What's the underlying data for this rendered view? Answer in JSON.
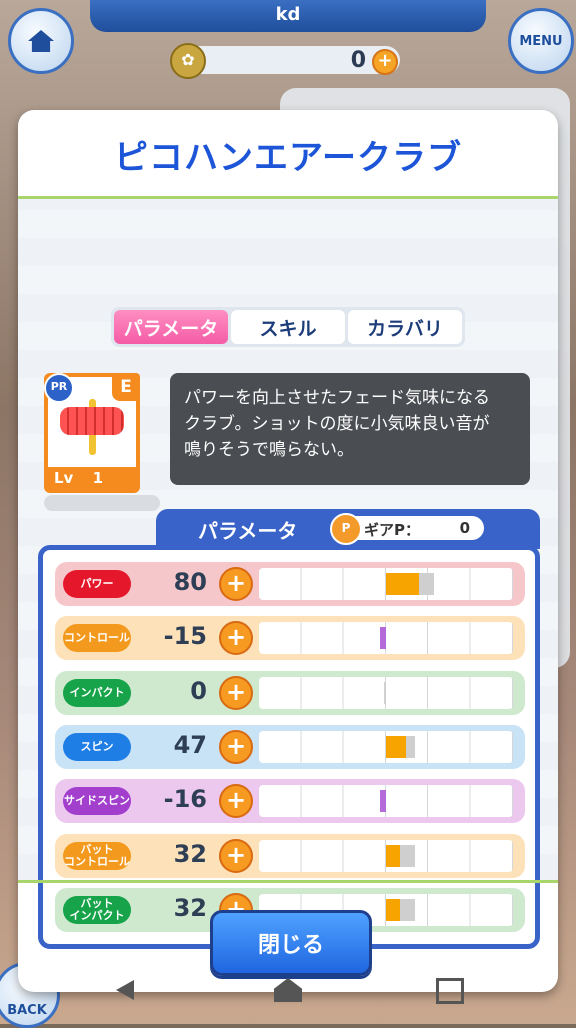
{
  "hud": {
    "player_name": "kd",
    "coins": "0",
    "menu_label": "MENU",
    "back_label": "BACK"
  },
  "dialog": {
    "title": "ピコハンエアークラブ",
    "tabs": [
      {
        "label": "パラメータ",
        "active": true
      },
      {
        "label": "スキル",
        "active": false
      },
      {
        "label": "カラバリ",
        "active": false
      }
    ],
    "item": {
      "badge": "PR",
      "rank": "E",
      "level_label": "Lv",
      "level": "1"
    },
    "description": "パワーを向上させたフェード気味になる\nクラブ。ショットの度に小気味良い音が\n鳴りそうで鳴らない。",
    "params_title": "パラメータ",
    "gear_label": "ギアP：",
    "gear_value": "0",
    "params": [
      {
        "label": "パワー",
        "value": "80",
        "base_fraction": 0.5,
        "bonus_fraction": 0.13,
        "total_fraction": 0.19,
        "color": "#e5182b",
        "row_bg": "#f6c7ca"
      },
      {
        "label": "コントロール",
        "value": "-15",
        "neg_fraction": 0.025,
        "color": "#f39a1e",
        "row_bg": "#fde1b8"
      },
      {
        "label": "インパクト",
        "value": "0",
        "neg_fraction": 0.0,
        "color": "#17a34a",
        "row_bg": "#cfe9cf"
      },
      {
        "label": "スピン",
        "value": "47",
        "base_fraction": 0.5,
        "bonus_fraction": 0.08,
        "total_fraction": 0.115,
        "color": "#1f7ee6",
        "row_bg": "#c8e2f6"
      },
      {
        "label": "サイドスピン",
        "value": "-16",
        "neg_fraction": 0.025,
        "color": "#a23fcd",
        "row_bg": "#ecc8ef"
      },
      {
        "label": "バット\nコントロール",
        "value": "32",
        "base_fraction": 0.5,
        "bonus_fraction": 0.055,
        "total_fraction": 0.115,
        "color": "#f39a1e",
        "row_bg": "#fde1b8"
      },
      {
        "label": "バット\nインパクト",
        "value": "32",
        "base_fraction": 0.5,
        "bonus_fraction": 0.055,
        "total_fraction": 0.115,
        "color": "#17a34a",
        "row_bg": "#cfe9cf"
      }
    ],
    "close_label": "閉じる"
  }
}
